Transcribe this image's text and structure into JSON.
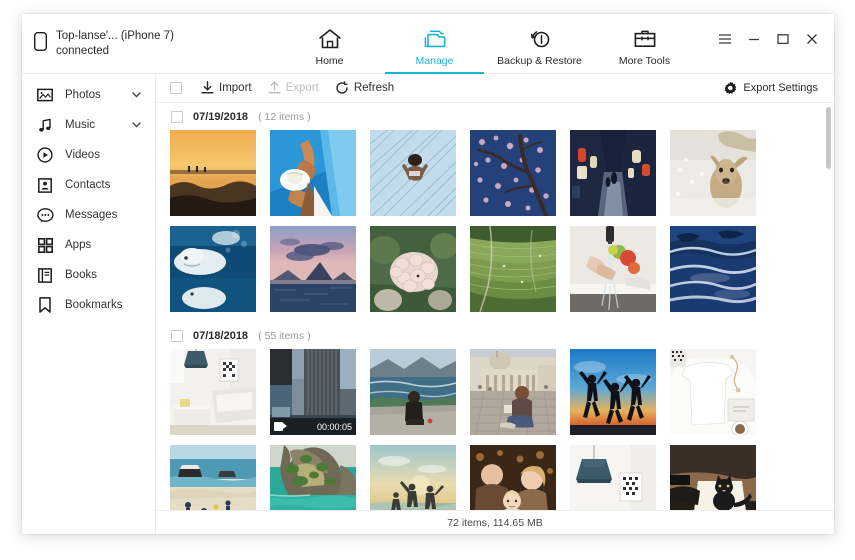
{
  "window": {
    "controls": [
      {
        "name": "menu",
        "glyph": "☰"
      },
      {
        "name": "minimize",
        "glyph": "−"
      },
      {
        "name": "maximize",
        "glyph": "☐"
      },
      {
        "name": "close",
        "glyph": "✕"
      }
    ]
  },
  "device": {
    "icon": "phone-icon",
    "name": "Top-lanse'... (iPhone 7)",
    "status": "connected"
  },
  "nav": {
    "active_index": 1,
    "items": [
      {
        "label": "Home",
        "icon": "home-icon"
      },
      {
        "label": "Manage",
        "icon": "folder-icon"
      },
      {
        "label": "Backup & Restore",
        "icon": "backup-restore-icon"
      },
      {
        "label": "More Tools",
        "icon": "toolbox-icon"
      }
    ]
  },
  "sidebar": {
    "items": [
      {
        "label": "Photos",
        "icon": "photo-icon",
        "expandable": true,
        "selected": true
      },
      {
        "label": "Music",
        "icon": "music-note-icon",
        "expandable": true,
        "selected": false
      },
      {
        "label": "Videos",
        "icon": "play-circle-icon",
        "expandable": false,
        "selected": false
      },
      {
        "label": "Contacts",
        "icon": "contact-card-icon",
        "expandable": false,
        "selected": false
      },
      {
        "label": "Messages",
        "icon": "message-bubble-icon",
        "expandable": false,
        "selected": false
      },
      {
        "label": "Apps",
        "icon": "grid-apps-icon",
        "expandable": false,
        "selected": false
      },
      {
        "label": "Books",
        "icon": "book-icon",
        "expandable": false,
        "selected": false
      },
      {
        "label": "Bookmarks",
        "icon": "bookmark-icon",
        "expandable": false,
        "selected": false
      }
    ]
  },
  "toolbar": {
    "select_all_checked": false,
    "import_label": "Import",
    "export_label": "Export",
    "export_disabled": true,
    "refresh_label": "Refresh",
    "export_settings_label": "Export Settings"
  },
  "groups": [
    {
      "date": "07/19/2018",
      "count_label": "( 12 items )",
      "checked": false,
      "rows": [
        [
          {
            "name": "sunset-beach",
            "type": "photo"
          },
          {
            "name": "pool-sunhat",
            "type": "photo"
          },
          {
            "name": "swimmer-pool",
            "type": "photo"
          },
          {
            "name": "cherry-blossom-night",
            "type": "photo"
          },
          {
            "name": "lantern-alley",
            "type": "photo"
          },
          {
            "name": "deer-snow",
            "type": "photo"
          }
        ],
        [
          {
            "name": "beluga-whale",
            "type": "photo"
          },
          {
            "name": "dusk-mountain-sea",
            "type": "photo"
          },
          {
            "name": "hydrangea-flower",
            "type": "photo"
          },
          {
            "name": "rice-terrace-aerial",
            "type": "photo"
          },
          {
            "name": "washing-fruit-sink",
            "type": "photo"
          },
          {
            "name": "ocean-waves",
            "type": "photo"
          }
        ]
      ]
    },
    {
      "date": "07/18/2018",
      "count_label": "( 55 items )",
      "checked": false,
      "rows": [
        [
          {
            "name": "white-living-room",
            "type": "photo"
          },
          {
            "name": "city-skyscraper",
            "type": "video",
            "duration": "00:00:05"
          },
          {
            "name": "woman-sitting-coast",
            "type": "photo"
          },
          {
            "name": "tourist-basilica",
            "type": "photo"
          },
          {
            "name": "jumping-silhouettes",
            "type": "photo"
          },
          {
            "name": "white-tshirt-flatlay",
            "type": "photo"
          }
        ],
        [
          {
            "name": "tropical-beach-boats",
            "type": "photo"
          },
          {
            "name": "limestone-cliff-lagoon",
            "type": "photo"
          },
          {
            "name": "couple-sea-sunset",
            "type": "photo"
          },
          {
            "name": "family-portrait",
            "type": "photo"
          },
          {
            "name": "pendant-lamp-room",
            "type": "photo"
          },
          {
            "name": "cat-on-lap",
            "type": "photo"
          }
        ]
      ]
    }
  ],
  "status": {
    "summary": "72 items, 114.65 MB"
  },
  "colors": {
    "accent": "#1ab2d6",
    "text": "#2b2b2b",
    "muted": "#9b9b9b",
    "disabled": "#bdbdbd",
    "border": "#ededed"
  }
}
